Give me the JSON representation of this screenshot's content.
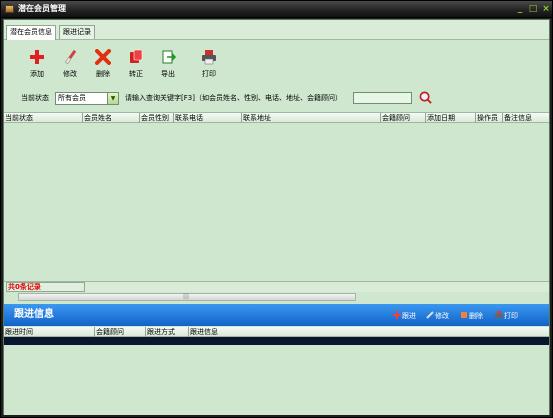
{
  "window": {
    "title": "潜在会员管理",
    "minimize": "_",
    "maximize": "□",
    "close": "×"
  },
  "tabs": [
    {
      "label": "潜在会员信息",
      "active": true
    },
    {
      "label": "跟进记录",
      "active": false
    }
  ],
  "toolbar": {
    "add": "添加",
    "edit": "修改",
    "delete": "删除",
    "convert": "转正",
    "export": "导出",
    "print": "打印"
  },
  "filter": {
    "status_label": "当前状态",
    "status_value": "所有会员",
    "keyword_label": "请输入查询关键字[F3]（如会员姓名、性别、电话、地址、会籍顾问）",
    "keyword_value": ""
  },
  "grid": {
    "columns": [
      "当前状态",
      "会员姓名",
      "会员性别",
      "联系电话",
      "联系地址",
      "会籍顾问",
      "添加日期",
      "操作员",
      "备注信息"
    ],
    "rows": []
  },
  "record_count": "共0条记录",
  "scroll_grip": "|||",
  "followup": {
    "title": "跟进信息",
    "actions": {
      "follow": "跟进",
      "edit": "修改",
      "delete": "删除",
      "print": "打印"
    },
    "columns": [
      "跟进时间",
      "会籍顾问",
      "跟进方式",
      "跟进信息"
    ]
  },
  "colors": {
    "panel_bg": "#cfe7cf",
    "accent_blue": "#1a74dc",
    "count_red": "#e00000"
  }
}
